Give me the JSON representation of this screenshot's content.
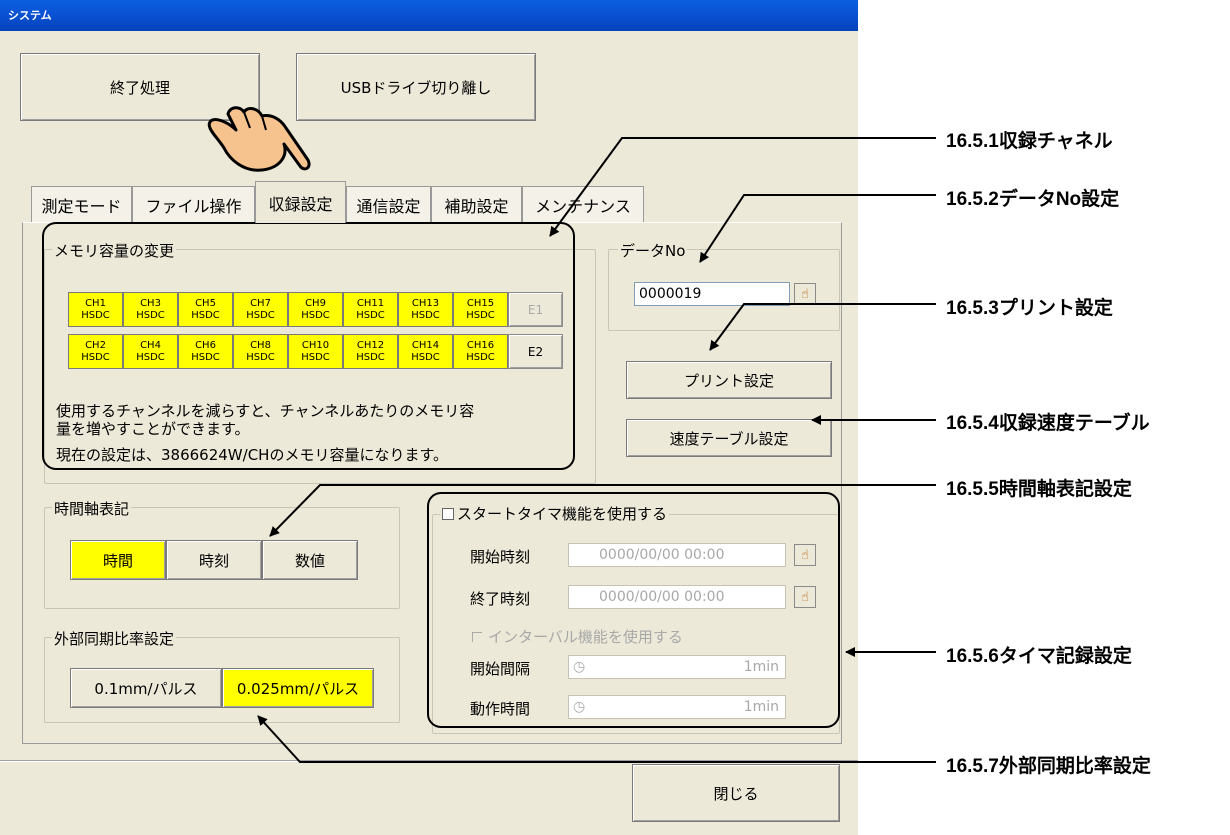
{
  "window": {
    "title": "システム"
  },
  "top_buttons": {
    "shutdown": "終了処理",
    "usb_eject": "USBドライブ切り離し"
  },
  "tabs": [
    "測定モード",
    "ファイル操作",
    "収録設定",
    "通信設定",
    "補助設定",
    "メンテナンス"
  ],
  "memory": {
    "legend": "メモリ容量の変更",
    "channels_row1": [
      {
        "ch": "CH1",
        "type": "HSDC"
      },
      {
        "ch": "CH3",
        "type": "HSDC"
      },
      {
        "ch": "CH5",
        "type": "HSDC"
      },
      {
        "ch": "CH7",
        "type": "HSDC"
      },
      {
        "ch": "CH9",
        "type": "HSDC"
      },
      {
        "ch": "CH11",
        "type": "HSDC"
      },
      {
        "ch": "CH13",
        "type": "HSDC"
      },
      {
        "ch": "CH15",
        "type": "HSDC"
      }
    ],
    "channels_row2": [
      {
        "ch": "CH2",
        "type": "HSDC"
      },
      {
        "ch": "CH4",
        "type": "HSDC"
      },
      {
        "ch": "CH6",
        "type": "HSDC"
      },
      {
        "ch": "CH8",
        "type": "HSDC"
      },
      {
        "ch": "CH10",
        "type": "HSDC"
      },
      {
        "ch": "CH12",
        "type": "HSDC"
      },
      {
        "ch": "CH14",
        "type": "HSDC"
      },
      {
        "ch": "CH16",
        "type": "HSDC"
      }
    ],
    "e1": "E1",
    "e2": "E2",
    "note_line1": "使用するチャンネルを減らすと、チャンネルあたりのメモリ容",
    "note_line2": "量を増やすことができます。",
    "note_line3": "現在の設定は、3866624W/CHのメモリ容量になります。"
  },
  "data_no": {
    "legend": "データNo",
    "value": "0000019"
  },
  "print_settings": "プリント設定",
  "speed_table": "速度テーブル設定",
  "time_axis": {
    "legend": "時間軸表記",
    "options": [
      "時間",
      "時刻",
      "数値"
    ]
  },
  "ext_sync": {
    "legend": "外部同期比率設定",
    "options": [
      "0.1mm/パルス",
      "0.025mm/パルス"
    ]
  },
  "start_timer": {
    "legend": "スタートタイマ機能を使用する",
    "start_time_label": "開始時刻",
    "start_time_value": "0000/00/00 00:00",
    "end_time_label": "終了時刻",
    "end_time_value": "0000/00/00 00:00",
    "interval_check": "インターバル機能を使用する",
    "interval_label": "開始間隔",
    "interval_value": "1min",
    "duration_label": "動作時間",
    "duration_value": "1min"
  },
  "close": "閉じる",
  "annotations": [
    "16.5.1収録チャネル",
    "16.5.2データNo設定",
    "16.5.3プリント設定",
    "16.5.4収録速度テーブル",
    "16.5.5時間軸表記設定",
    "16.5.6タイマ記録設定",
    "16.5.7外部同期比率設定"
  ],
  "colors": {
    "selected": "#ffff00",
    "titlebar": "#0a4fd0",
    "window_bg": "#ece9d8"
  }
}
